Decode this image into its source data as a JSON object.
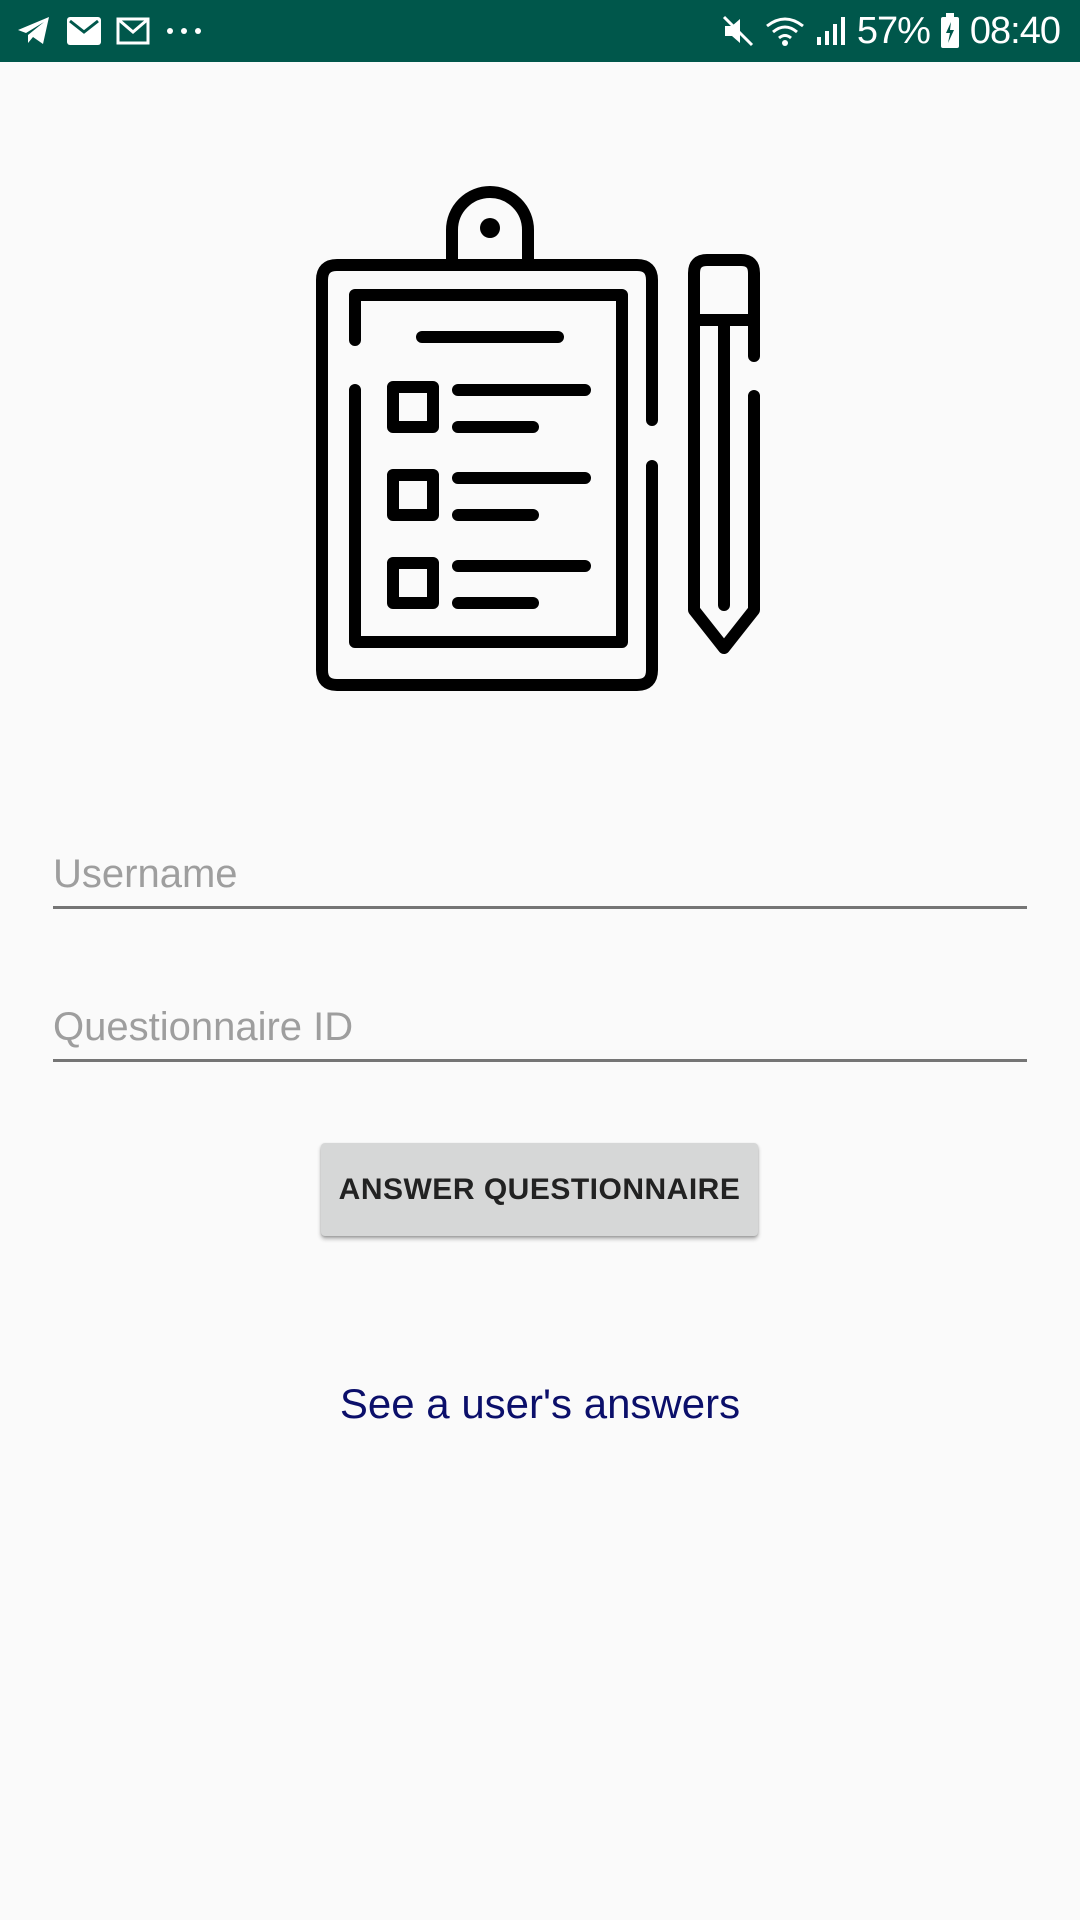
{
  "status_bar": {
    "left_icons": [
      "telegram-icon",
      "email-icon",
      "gmail-icon",
      "more-notifications-icon"
    ],
    "right_icons": [
      "mute-icon",
      "wifi-icon",
      "signal-icon",
      "battery-icon"
    ],
    "battery_percent": "57%",
    "time": "08:40",
    "background": "#00574b"
  },
  "illustration": {
    "icon": "clipboard-checklist-pencil-icon"
  },
  "form": {
    "username_placeholder": "Username",
    "questionnaire_id_placeholder": "Questionnaire ID",
    "answer_button_label": "ANSWER QUESTIONNAIRE"
  },
  "links": {
    "see_answers": "See a user's answers"
  },
  "colors": {
    "background": "#fafafa",
    "button_bg": "#d6d7d7",
    "link": "#0b0f6a",
    "underline": "#757575"
  }
}
